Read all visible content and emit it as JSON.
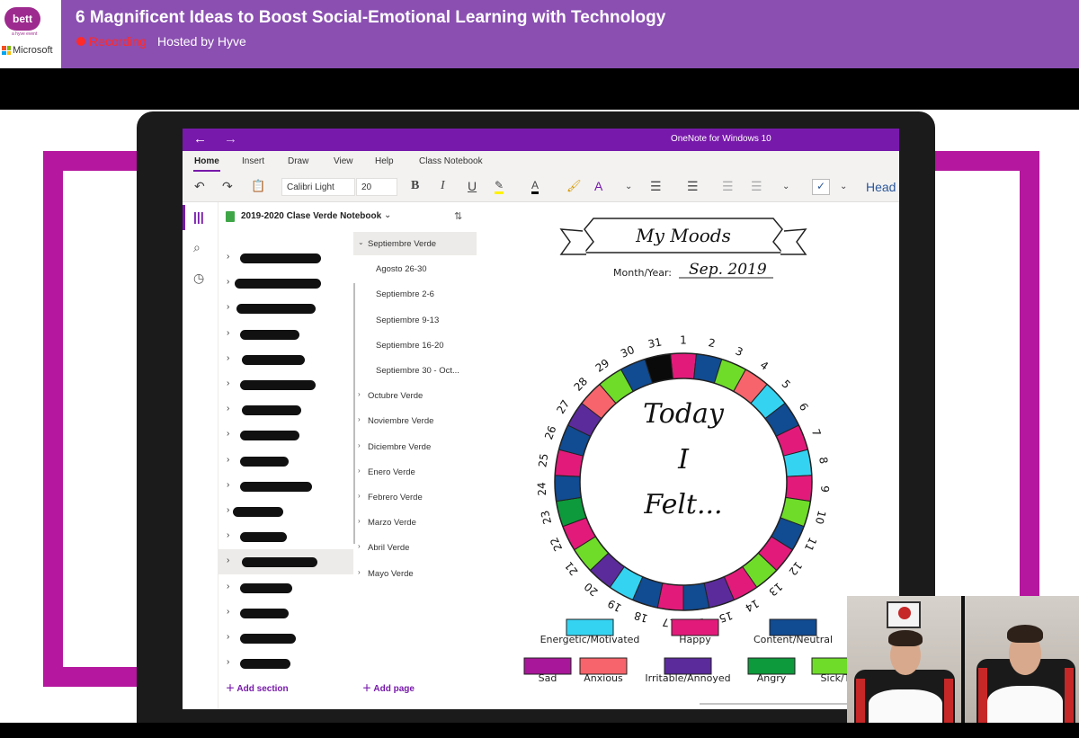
{
  "banner": {
    "title": "6 Magnificent Ideas to Boost Social-Emotional Learning with Technology",
    "recording_label": "Recording",
    "host": "Hosted by Hyve",
    "bett_logo": "bett",
    "bett_sub": "a hyve event",
    "microsoft_label": "Microsoft",
    "accent": "#8a4fb1"
  },
  "onenote": {
    "app_title": "OneNote for Windows 10",
    "tabs": [
      "Home",
      "Insert",
      "Draw",
      "View",
      "Help",
      "Class Notebook"
    ],
    "font_name": "Calibri Light",
    "font_size": "20",
    "heading_label": "Head",
    "notebook_title": "2019-2020 Clase Verde Notebook",
    "add_section": "Add section",
    "add_page": "Add page",
    "pages": [
      {
        "label": "Septiembre Verde",
        "level": 0,
        "expanded": true,
        "active": true
      },
      {
        "label": "Agosto 26-30",
        "level": 1
      },
      {
        "label": "Septiembre 2-6",
        "level": 1
      },
      {
        "label": "Septiembre 9-13",
        "level": 1
      },
      {
        "label": "Septiembre 16-20",
        "level": 1
      },
      {
        "label": "Septiembre 30 - Oct...",
        "level": 1
      },
      {
        "label": "Octubre Verde",
        "level": 0
      },
      {
        "label": "Noviembre Verde",
        "level": 0
      },
      {
        "label": "Diciembre Verde",
        "level": 0
      },
      {
        "label": "Enero Verde",
        "level": 0
      },
      {
        "label": "Febrero Verde",
        "level": 0
      },
      {
        "label": "Marzo Verde",
        "level": 0
      },
      {
        "label": "Abril Verde",
        "level": 0
      },
      {
        "label": "Mayo Verde",
        "level": 0
      }
    ],
    "section_count": 17,
    "selected_section": 12,
    "accent": "#7719aa"
  },
  "mood_tracker": {
    "title": "My Moods",
    "month_year_label": "Month/Year",
    "month_year_value": "Sep. 2019",
    "center_text": [
      "Today",
      "I",
      "Felt..."
    ],
    "days": [
      {
        "day": "1",
        "mood": "Happy"
      },
      {
        "day": "2",
        "mood": "Content/Neutral"
      },
      {
        "day": "3",
        "mood": "Sick/Tired"
      },
      {
        "day": "4",
        "mood": "Anxious"
      },
      {
        "day": "5",
        "mood": "Energetic/Motivated"
      },
      {
        "day": "6",
        "mood": "Content/Neutral"
      },
      {
        "day": "7",
        "mood": "Happy"
      },
      {
        "day": "8",
        "mood": "Energetic/Motivated"
      },
      {
        "day": "9",
        "mood": "Happy"
      },
      {
        "day": "10",
        "mood": "Sick/Tired"
      },
      {
        "day": "11",
        "mood": "Content/Neutral"
      },
      {
        "day": "12",
        "mood": "Happy"
      },
      {
        "day": "13",
        "mood": "Sick/Tired"
      },
      {
        "day": "14",
        "mood": "Happy"
      },
      {
        "day": "15",
        "mood": "Irritable/Annoyed"
      },
      {
        "day": "16",
        "mood": "Content/Neutral"
      },
      {
        "day": "17",
        "mood": "Happy"
      },
      {
        "day": "18",
        "mood": "Content/Neutral"
      },
      {
        "day": "19",
        "mood": "Energetic/Motivated"
      },
      {
        "day": "20",
        "mood": "Irritable/Annoyed"
      },
      {
        "day": "21",
        "mood": "Sick/Tired"
      },
      {
        "day": "22",
        "mood": "Happy"
      },
      {
        "day": "23",
        "mood": "Angry"
      },
      {
        "day": "24",
        "mood": "Content/Neutral"
      },
      {
        "day": "25",
        "mood": "Happy"
      },
      {
        "day": "26",
        "mood": "Content/Neutral"
      },
      {
        "day": "27",
        "mood": "Irritable/Annoyed"
      },
      {
        "day": "28",
        "mood": "Anxious"
      },
      {
        "day": "29",
        "mood": "Sick/Tired"
      },
      {
        "day": "30",
        "mood": "Content/Neutral"
      },
      {
        "day": "31",
        "mood": "Blank"
      }
    ],
    "legend": [
      {
        "label": "Energetic/Motivated",
        "color": "#35d3f2"
      },
      {
        "label": "Happy",
        "color": "#e21b7a"
      },
      {
        "label": "Content/Neutral",
        "color": "#114b91"
      },
      {
        "label": "Sad",
        "color": "#a8179a"
      },
      {
        "label": "Anxious",
        "color": "#f7646b"
      },
      {
        "label": "Irritable/Annoyed",
        "color": "#5b2b9c"
      },
      {
        "label": "Angry",
        "color": "#0d9a3c"
      },
      {
        "label": "Sick/T",
        "color": "#6fdc2a"
      }
    ],
    "mood_colors": {
      "Energetic/Motivated": "#35d3f2",
      "Happy": "#e21b7a",
      "Content/Neutral": "#114b91",
      "Sad": "#a8179a",
      "Anxious": "#f7646b",
      "Irritable/Annoyed": "#5b2b9c",
      "Angry": "#0d9a3c",
      "Sick/Tired": "#6fdc2a",
      "Blank": "#0a0a0a"
    }
  }
}
